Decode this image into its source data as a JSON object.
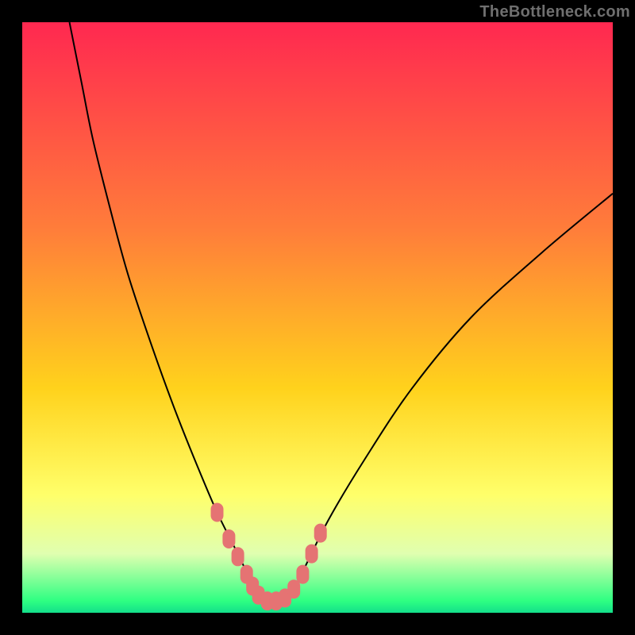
{
  "watermark": "TheBottleneck.com",
  "chart_data": {
    "type": "line",
    "title": "",
    "xlabel": "",
    "ylabel": "",
    "xlim": [
      0,
      100
    ],
    "ylim": [
      0,
      100
    ],
    "background": {
      "gradient_stops": [
        {
          "pos": 0.0,
          "color": "#ff2850"
        },
        {
          "pos": 0.35,
          "color": "#ff7d3a"
        },
        {
          "pos": 0.62,
          "color": "#ffd21c"
        },
        {
          "pos": 0.8,
          "color": "#ffff6a"
        },
        {
          "pos": 0.9,
          "color": "#e0ffb0"
        },
        {
          "pos": 0.98,
          "color": "#2eff82"
        },
        {
          "pos": 1.0,
          "color": "#13df8a"
        }
      ]
    },
    "series": [
      {
        "name": "bottleneck-curve",
        "color": "#000000",
        "x": [
          8,
          10,
          12,
          15,
          18,
          22,
          26,
          30,
          33,
          36,
          38,
          40,
          42,
          44,
          46,
          48,
          52,
          58,
          66,
          76,
          88,
          100
        ],
        "y": [
          100,
          90,
          80,
          68,
          57,
          45,
          34,
          24,
          17,
          11,
          7,
          4,
          2,
          2,
          4,
          8,
          16,
          26,
          38,
          50,
          61,
          71
        ]
      }
    ],
    "markers": {
      "name": "highlighted-points",
      "color": "#e57373",
      "points": [
        {
          "x": 33.0,
          "y": 17.0
        },
        {
          "x": 35.0,
          "y": 12.5
        },
        {
          "x": 36.5,
          "y": 9.5
        },
        {
          "x": 38.0,
          "y": 6.5
        },
        {
          "x": 39.0,
          "y": 4.5
        },
        {
          "x": 40.0,
          "y": 3.0
        },
        {
          "x": 41.5,
          "y": 2.0
        },
        {
          "x": 43.0,
          "y": 2.0
        },
        {
          "x": 44.5,
          "y": 2.5
        },
        {
          "x": 46.0,
          "y": 4.0
        },
        {
          "x": 47.5,
          "y": 6.5
        },
        {
          "x": 49.0,
          "y": 10.0
        },
        {
          "x": 50.5,
          "y": 13.5
        }
      ]
    }
  }
}
